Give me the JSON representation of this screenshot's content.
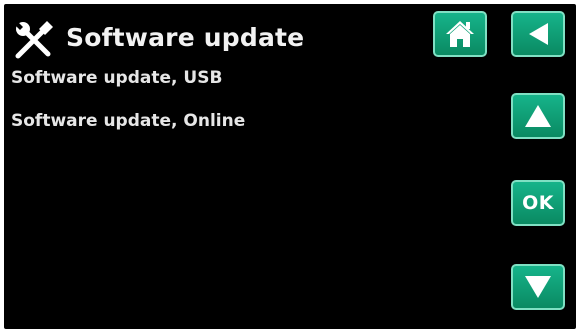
{
  "header": {
    "icon": "tools-icon",
    "title": "Software update"
  },
  "menu": {
    "items": [
      {
        "label": "Software update, USB"
      },
      {
        "label": "Software update, Online"
      }
    ]
  },
  "buttons": {
    "home_icon": "home-icon",
    "back_icon": "back-arrow-icon",
    "up_icon": "up-arrow-icon",
    "ok_label": "OK",
    "down_icon": "down-arrow-icon"
  },
  "colors": {
    "background": "#000000",
    "text": "#e6e6e6",
    "button_green": "#0fa078",
    "button_border": "#7fe0c3"
  }
}
